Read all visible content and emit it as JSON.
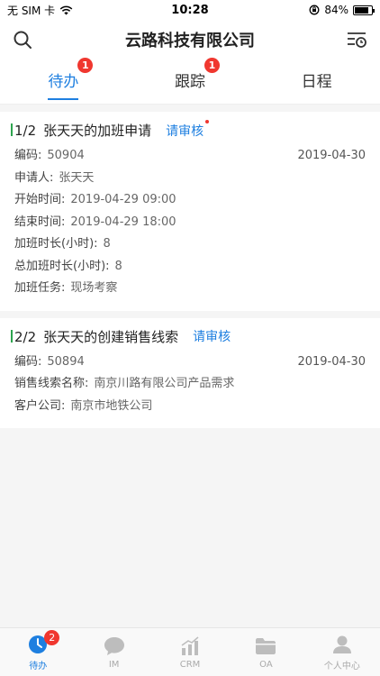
{
  "status_bar": {
    "carrier": "无 SIM 卡",
    "time": "10:28",
    "battery": "84%",
    "battery_level": 0.84
  },
  "header": {
    "title": "云路科技有限公司",
    "search_icon": "search-icon",
    "history_icon": "history-filter-icon"
  },
  "tabs": [
    {
      "label": "待办",
      "badge": "1",
      "active": true
    },
    {
      "label": "跟踪",
      "badge": "1",
      "active": false
    },
    {
      "label": "日程",
      "badge": "",
      "active": false
    }
  ],
  "cards": [
    {
      "index": "1/2",
      "title": "张天天的加班申请",
      "status": "请审核",
      "code_label": "编码:",
      "code": "50904",
      "date": "2019-04-30",
      "fields": [
        {
          "label": "申请人:",
          "value": "张天天"
        },
        {
          "label": "开始时间:",
          "value": "2019-04-29 09:00"
        },
        {
          "label": "结束时间:",
          "value": "2019-04-29 18:00"
        },
        {
          "label": "加班时长(小时):",
          "value": "8"
        },
        {
          "label": "总加班时长(小时):",
          "value": "8"
        },
        {
          "label": "加班任务:",
          "value": "现场考察"
        }
      ]
    },
    {
      "index": "2/2",
      "title": "张天天的创建销售线索",
      "status": "请审核",
      "code_label": "编码:",
      "code": "50894",
      "date": "2019-04-30",
      "fields": [
        {
          "label": "销售线索名称:",
          "value": "南京川路有限公司产品需求"
        },
        {
          "label": "客户公司:",
          "value": "南京市地铁公司"
        }
      ]
    }
  ],
  "tabbar": [
    {
      "label": "待办",
      "icon": "todo-clock-icon",
      "badge": "2",
      "active": true
    },
    {
      "label": "IM",
      "icon": "chat-bubble-icon",
      "badge": "",
      "active": false
    },
    {
      "label": "CRM",
      "icon": "bar-chart-icon",
      "badge": "",
      "active": false
    },
    {
      "label": "OA",
      "icon": "folder-icon",
      "badge": "",
      "active": false
    },
    {
      "label": "个人中心",
      "icon": "person-icon",
      "badge": "",
      "active": false
    }
  ],
  "colors": {
    "accent": "#1e7fe0",
    "badge": "#f0372f",
    "card_marker": "#2ea44f"
  }
}
